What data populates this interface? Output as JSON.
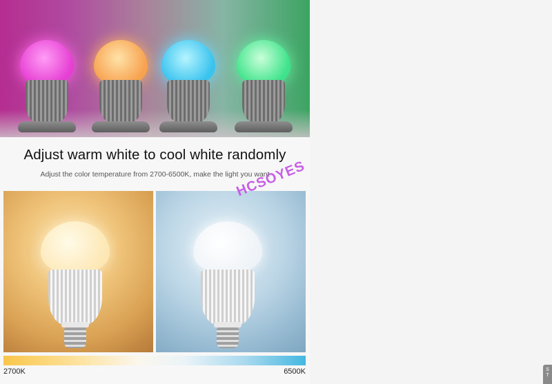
{
  "hero": {
    "bulbs": [
      {
        "color_name": "magenta",
        "color": "#e63fd3"
      },
      {
        "color_name": "orange",
        "color": "#f7a24f"
      },
      {
        "color_name": "cyan",
        "color": "#39c3ee"
      },
      {
        "color_name": "green",
        "color": "#3fe38c"
      }
    ]
  },
  "headline": "Adjust warm white to cool white randomly",
  "subline": "Adjust the color temperature from 2700-6500K, make the light you want",
  "watermark": "HCSOYES",
  "photos": {
    "warm": {
      "tint": "#e2b06a"
    },
    "cool": {
      "tint": "#b7d2e3"
    }
  },
  "temperature_scale": {
    "min_label": "2700K",
    "max_label": "6500K",
    "start_color": "#f9c64a",
    "end_color": "#44b8e0"
  },
  "side_tab": {
    "text": "S\nT"
  }
}
